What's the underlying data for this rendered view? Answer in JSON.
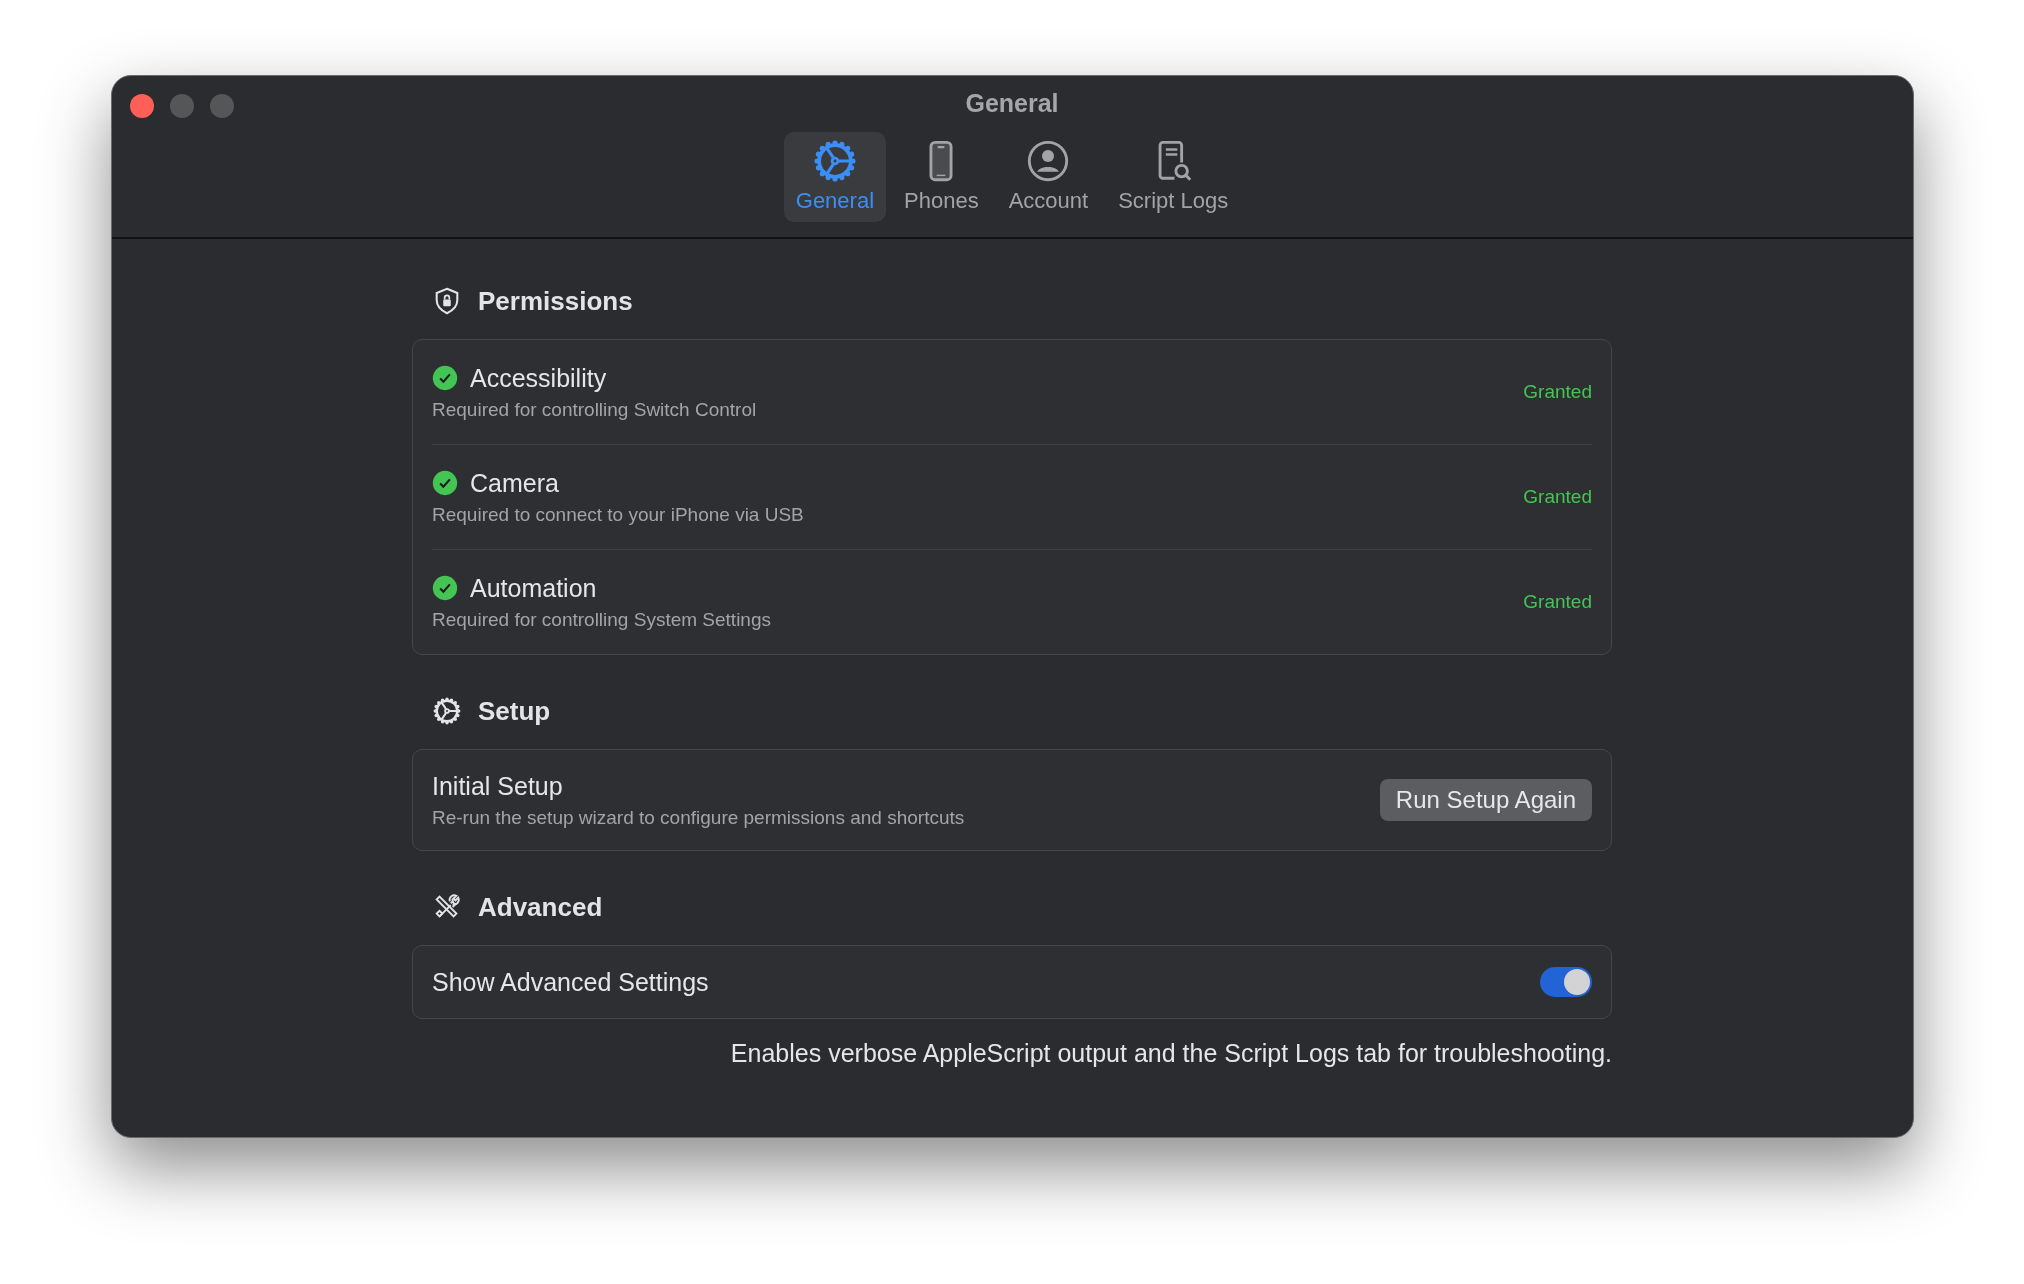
{
  "window": {
    "title": "General"
  },
  "tabs": [
    {
      "label": "General",
      "selected": true
    },
    {
      "label": "Phones",
      "selected": false
    },
    {
      "label": "Account",
      "selected": false
    },
    {
      "label": "Script Logs",
      "selected": false
    }
  ],
  "permissions": {
    "title": "Permissions",
    "items": [
      {
        "name": "Accessibility",
        "description": "Required for controlling Switch Control",
        "granted": true,
        "status": "Granted"
      },
      {
        "name": "Camera",
        "description": "Required to connect to your iPhone via USB",
        "granted": true,
        "status": "Granted"
      },
      {
        "name": "Automation",
        "description": "Required for controlling System Settings",
        "granted": true,
        "status": "Granted"
      }
    ]
  },
  "setup": {
    "title": "Setup",
    "name": "Initial Setup",
    "description": "Re-run the setup wizard to configure permissions and shortcuts",
    "button": "Run Setup Again"
  },
  "advanced": {
    "title": "Advanced",
    "label": "Show Advanced Settings",
    "on": true,
    "note": "Enables verbose AppleScript output and the Script Logs tab for troubleshooting."
  }
}
